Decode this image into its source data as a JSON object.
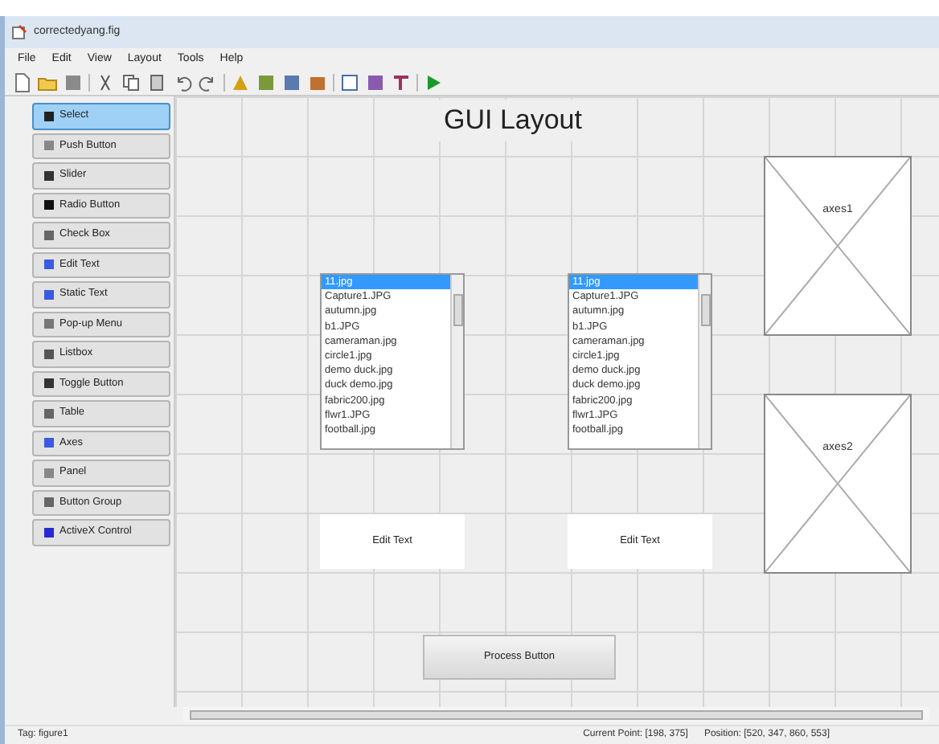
{
  "window": {
    "title": "correctedyang.fig"
  },
  "menu": [
    "File",
    "Edit",
    "View",
    "Layout",
    "Tools",
    "Help"
  ],
  "palette": [
    {
      "label": "Select",
      "selected": true
    },
    {
      "label": "Push Button",
      "selected": false
    },
    {
      "label": "Slider",
      "selected": false
    },
    {
      "label": "Radio Button",
      "selected": false
    },
    {
      "label": "Check Box",
      "selected": false
    },
    {
      "label": "Edit Text",
      "selected": false
    },
    {
      "label": "Static Text",
      "selected": false
    },
    {
      "label": "Pop-up Menu",
      "selected": false
    },
    {
      "label": "Listbox",
      "selected": false
    },
    {
      "label": "Toggle Button",
      "selected": false
    },
    {
      "label": "Table",
      "selected": false
    },
    {
      "label": "Axes",
      "selected": false
    },
    {
      "label": "Panel",
      "selected": false
    },
    {
      "label": "Button Group",
      "selected": false
    },
    {
      "label": "ActiveX Control",
      "selected": false
    }
  ],
  "canvas": {
    "title": "GUI Layout",
    "listboxes": [
      {
        "items": [
          {
            "text": "11.jpg",
            "selected": true
          },
          {
            "text": "Capture1.JPG",
            "selected": false
          },
          {
            "text": "autumn.jpg",
            "selected": false
          },
          {
            "text": "b1.JPG",
            "selected": false
          },
          {
            "text": "cameraman.jpg",
            "selected": false
          },
          {
            "text": "circle1.jpg",
            "selected": false
          },
          {
            "text": "demo duck.jpg",
            "selected": false
          },
          {
            "text": "duck demo.jpg",
            "selected": false
          },
          {
            "text": "fabric200.jpg",
            "selected": false
          },
          {
            "text": "flwr1.JPG",
            "selected": false
          },
          {
            "text": "football.jpg",
            "selected": false
          }
        ]
      },
      {
        "items": [
          {
            "text": "11.jpg",
            "selected": true
          },
          {
            "text": "Capture1.JPG",
            "selected": false
          },
          {
            "text": "autumn.jpg",
            "selected": false
          },
          {
            "text": "b1.JPG",
            "selected": false
          },
          {
            "text": "cameraman.jpg",
            "selected": false
          },
          {
            "text": "circle1.jpg",
            "selected": false
          },
          {
            "text": "demo duck.jpg",
            "selected": false
          },
          {
            "text": "duck demo.jpg",
            "selected": false
          },
          {
            "text": "fabric200.jpg",
            "selected": false
          },
          {
            "text": "flwr1.JPG",
            "selected": false
          },
          {
            "text": "football.jpg",
            "selected": false
          }
        ]
      }
    ],
    "edit_texts": [
      "Edit Text",
      "Edit Text"
    ],
    "axes": [
      "axes1",
      "axes2"
    ],
    "button": "Process Button"
  },
  "status_bar": {
    "tag": "Tag: figure1",
    "current_point": "Current Point:  [198, 375]",
    "position": "Position: [520, 347, 860, 553]"
  }
}
